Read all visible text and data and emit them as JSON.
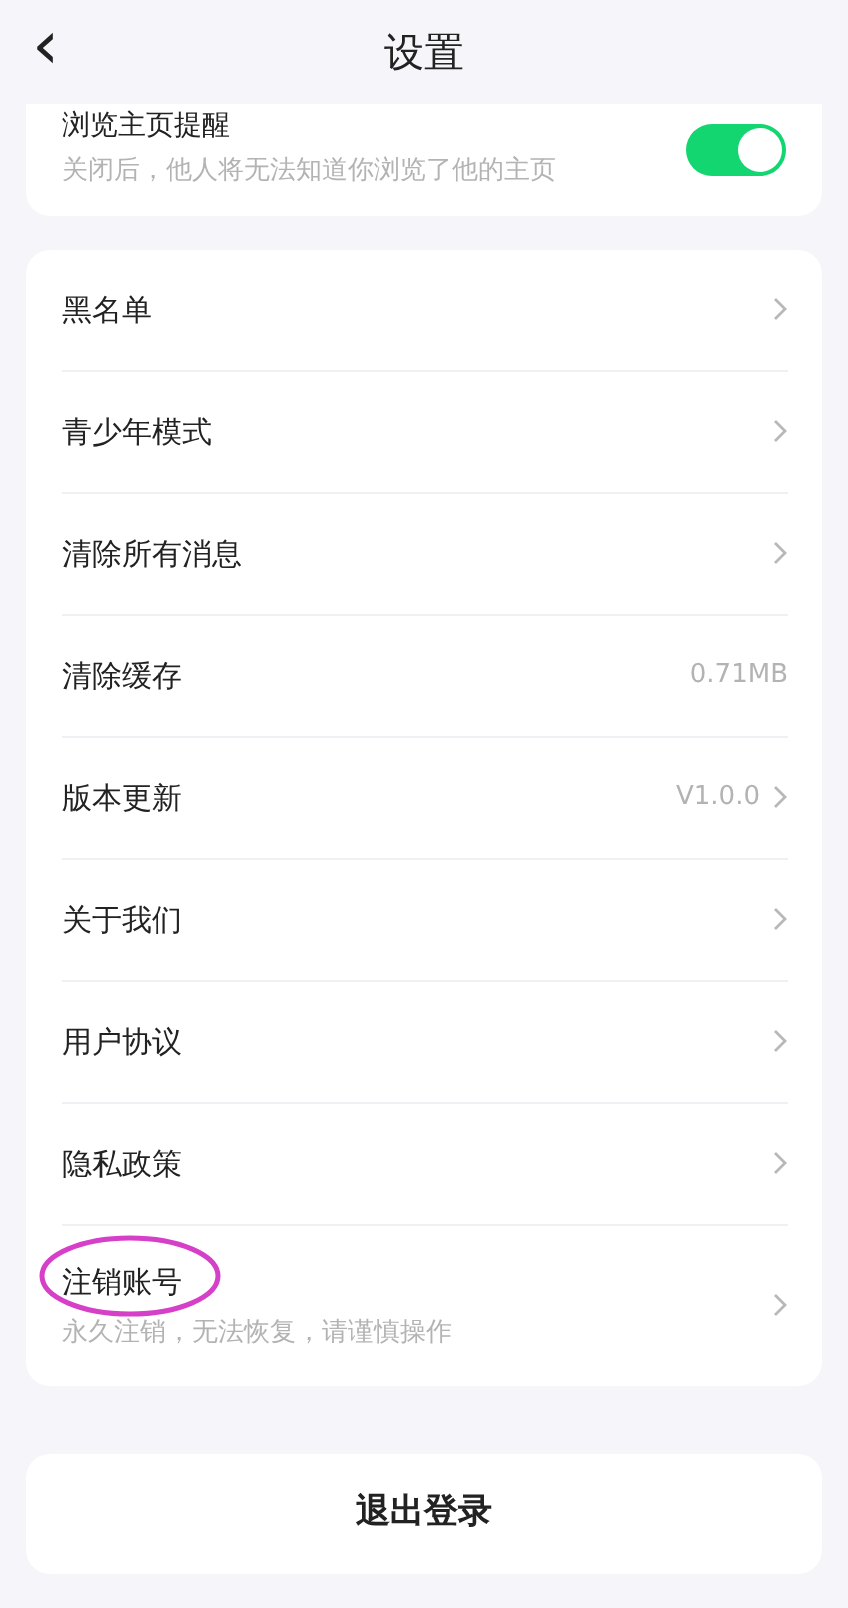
{
  "header": {
    "back": "‹",
    "title": "设置"
  },
  "notice": {
    "title": "浏览主页提醒",
    "subtitle": "关闭后，他人将无法知道你浏览了他的主页",
    "on": true
  },
  "items": [
    {
      "kind": "link",
      "label": "黑名单"
    },
    {
      "kind": "link",
      "label": "青少年模式"
    },
    {
      "kind": "link",
      "label": "清除所有消息"
    },
    {
      "kind": "value",
      "label": "清除缓存",
      "value": "0.71MB"
    },
    {
      "kind": "value_link",
      "label": "版本更新",
      "value": "V1.0.0"
    },
    {
      "kind": "link",
      "label": "关于我们"
    },
    {
      "kind": "link",
      "label": "用户协议"
    },
    {
      "kind": "link",
      "label": "隐私政策"
    },
    {
      "kind": "link",
      "label": "注销账号",
      "subtitle": "永久注销，无法恢复，请谨慎操作",
      "circled": true
    }
  ],
  "logout": "退出登录"
}
